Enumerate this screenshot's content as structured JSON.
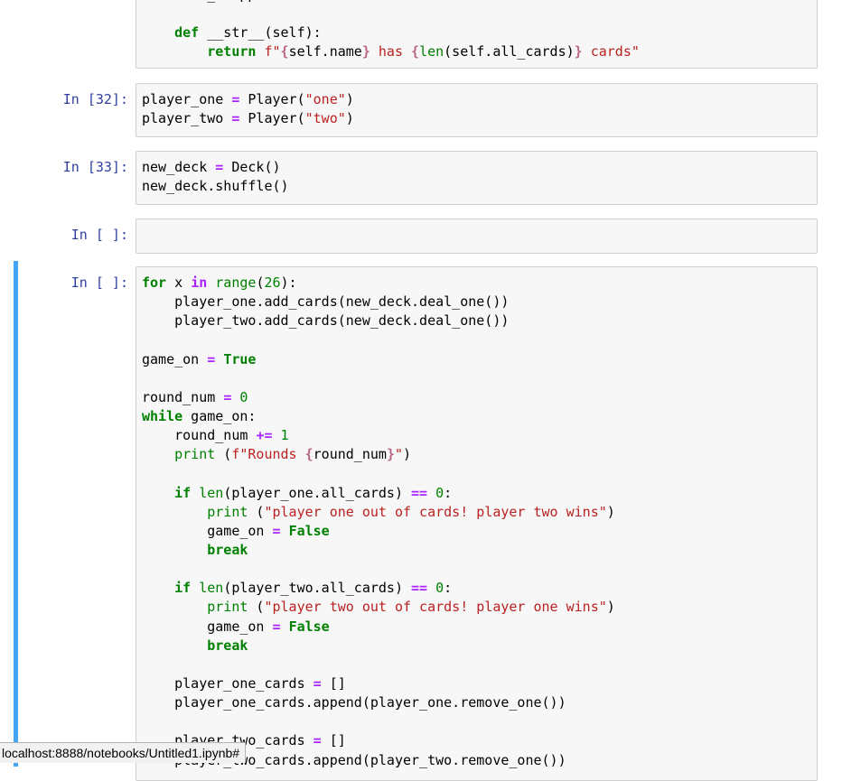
{
  "cells": [
    {
      "prompt": "",
      "lines": [
        [
          [
            "n",
            "        "
          ],
          [
            "n",
            "_"
          ],
          [
            "n",
            "   "
          ],
          [
            "n",
            "pp"
          ]
        ],
        [],
        [
          [
            "n",
            "    "
          ],
          [
            "kw",
            "def"
          ],
          [
            "n",
            " __str__(self):"
          ]
        ],
        [
          [
            "n",
            "        "
          ],
          [
            "kw",
            "return"
          ],
          [
            "n",
            " "
          ],
          [
            "str",
            "f\""
          ],
          [
            "i",
            "{"
          ],
          [
            "n",
            "self.name"
          ],
          [
            "i",
            "}"
          ],
          [
            "str",
            " has "
          ],
          [
            "i",
            "{"
          ],
          [
            "bi",
            "len"
          ],
          [
            "n",
            "(self.all_cards)"
          ],
          [
            "i",
            "}"
          ],
          [
            "str",
            " cards\""
          ]
        ]
      ]
    },
    {
      "prompt": "In [32]:",
      "lines": [
        [
          [
            "n",
            "player_one "
          ],
          [
            "op",
            "="
          ],
          [
            "n",
            " Player("
          ],
          [
            "str",
            "\"one\""
          ],
          [
            "n",
            ")"
          ]
        ],
        [
          [
            "n",
            "player_two "
          ],
          [
            "op",
            "="
          ],
          [
            "n",
            " Player("
          ],
          [
            "str",
            "\"two\""
          ],
          [
            "n",
            ")"
          ]
        ]
      ]
    },
    {
      "prompt": "In [33]:",
      "lines": [
        [
          [
            "n",
            "new_deck "
          ],
          [
            "op",
            "="
          ],
          [
            "n",
            " Deck()"
          ]
        ],
        [
          [
            "n",
            "new_deck.shuffle()"
          ]
        ]
      ]
    },
    {
      "prompt": "In [ ]:",
      "lines": [
        []
      ]
    },
    {
      "prompt": "In [ ]:",
      "lines": [
        [
          [
            "kw",
            "for"
          ],
          [
            "n",
            " x "
          ],
          [
            "op",
            "in"
          ],
          [
            "n",
            " "
          ],
          [
            "bi",
            "range"
          ],
          [
            "n",
            "("
          ],
          [
            "num",
            "26"
          ],
          [
            "n",
            "):"
          ]
        ],
        [
          [
            "n",
            "    player_one.add_cards(new_deck.deal_one())"
          ]
        ],
        [
          [
            "n",
            "    player_two.add_cards(new_deck.deal_one())"
          ]
        ],
        [],
        [
          [
            "n",
            "game_on "
          ],
          [
            "op",
            "="
          ],
          [
            "n",
            " "
          ],
          [
            "kwc",
            "True"
          ]
        ],
        [],
        [
          [
            "n",
            "round_num "
          ],
          [
            "op",
            "="
          ],
          [
            "n",
            " "
          ],
          [
            "num",
            "0"
          ]
        ],
        [
          [
            "kw",
            "while"
          ],
          [
            "n",
            " game_on:"
          ]
        ],
        [
          [
            "n",
            "    round_num "
          ],
          [
            "op",
            "+="
          ],
          [
            "n",
            " "
          ],
          [
            "num",
            "1"
          ]
        ],
        [
          [
            "n",
            "    "
          ],
          [
            "bi",
            "print"
          ],
          [
            "n",
            " ("
          ],
          [
            "str",
            "f\"Rounds "
          ],
          [
            "i",
            "{"
          ],
          [
            "n",
            "round_num"
          ],
          [
            "i",
            "}"
          ],
          [
            "str",
            "\""
          ],
          [
            "n",
            ")"
          ]
        ],
        [],
        [
          [
            "n",
            "    "
          ],
          [
            "kw",
            "if"
          ],
          [
            "n",
            " "
          ],
          [
            "bi",
            "len"
          ],
          [
            "n",
            "(player_one.all_cards) "
          ],
          [
            "op",
            "=="
          ],
          [
            "n",
            " "
          ],
          [
            "num",
            "0"
          ],
          [
            "n",
            ":"
          ]
        ],
        [
          [
            "n",
            "        "
          ],
          [
            "bi",
            "print"
          ],
          [
            "n",
            " ("
          ],
          [
            "str",
            "\"player one out of cards! player two wins\""
          ],
          [
            "n",
            ")"
          ]
        ],
        [
          [
            "n",
            "        game_on "
          ],
          [
            "op",
            "="
          ],
          [
            "n",
            " "
          ],
          [
            "kwc",
            "False"
          ]
        ],
        [
          [
            "n",
            "        "
          ],
          [
            "kw",
            "break"
          ]
        ],
        [],
        [
          [
            "n",
            "    "
          ],
          [
            "kw",
            "if"
          ],
          [
            "n",
            " "
          ],
          [
            "bi",
            "len"
          ],
          [
            "n",
            "(player_two.all_cards) "
          ],
          [
            "op",
            "=="
          ],
          [
            "n",
            " "
          ],
          [
            "num",
            "0"
          ],
          [
            "n",
            ":"
          ]
        ],
        [
          [
            "n",
            "        "
          ],
          [
            "bi",
            "print"
          ],
          [
            "n",
            " ("
          ],
          [
            "str",
            "\"player two out of cards! player one wins\""
          ],
          [
            "n",
            ")"
          ]
        ],
        [
          [
            "n",
            "        game_on "
          ],
          [
            "op",
            "="
          ],
          [
            "n",
            " "
          ],
          [
            "kwc",
            "False"
          ]
        ],
        [
          [
            "n",
            "        "
          ],
          [
            "kw",
            "break"
          ]
        ],
        [],
        [
          [
            "n",
            "    player_one_cards "
          ],
          [
            "op",
            "="
          ],
          [
            "n",
            " []"
          ]
        ],
        [
          [
            "n",
            "    player_one_cards.append(player_one.remove_one())"
          ]
        ],
        [],
        [
          [
            "n",
            "    player_two_cards "
          ],
          [
            "op",
            "="
          ],
          [
            "n",
            " []"
          ]
        ],
        [
          [
            "n",
            "    player_two_cards.append(player_two.remove_one())"
          ]
        ]
      ]
    }
  ],
  "status_bar": {
    "url": "localhost:8888/notebooks/Untitled1.ipynb#"
  },
  "colors": {
    "prompt": "#303f9f",
    "selected_bar": "#42a5f5",
    "keyword": "#008000",
    "operator": "#aa22ff",
    "string": "#ba2121",
    "interpolation": "#bb6688"
  }
}
